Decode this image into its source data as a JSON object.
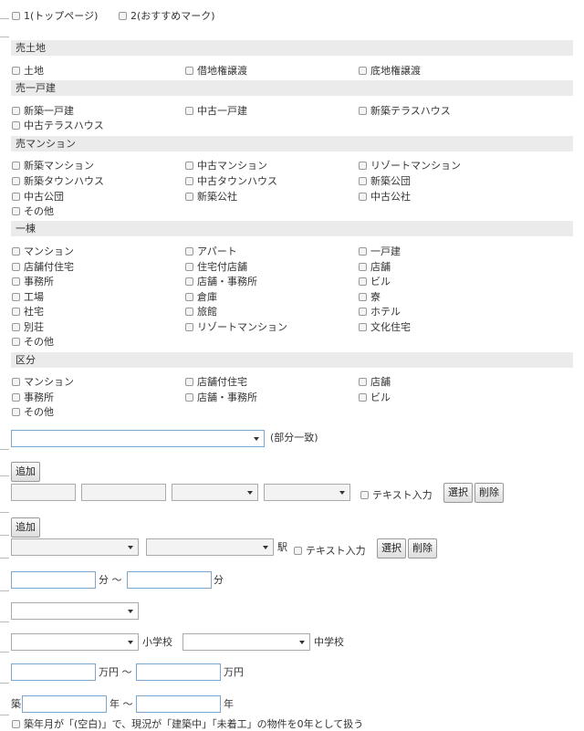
{
  "top": {
    "opt1": "1(トップページ)",
    "opt2": "2(おすすめマーク)"
  },
  "sections": {
    "tochi": {
      "title": "売土地",
      "items": [
        "土地",
        "借地権譲渡",
        "底地権譲渡"
      ]
    },
    "kodate": {
      "title": "売一戸建",
      "items": [
        "新築一戸建",
        "中古一戸建",
        "新築テラスハウス",
        "中古テラスハウス"
      ]
    },
    "mansion": {
      "title": "売マンション",
      "items": [
        "新築マンション",
        "中古マンション",
        "リゾートマンション",
        "新築タウンハウス",
        "中古タウンハウス",
        "新築公団",
        "中古公団",
        "新築公社",
        "中古公社",
        "その他"
      ]
    },
    "ittou": {
      "title": "一棟",
      "items": [
        "マンション",
        "アパート",
        "一戸建",
        "店舗付住宅",
        "住宅付店舗",
        "店舗",
        "事務所",
        "店舗・事務所",
        "ビル",
        "工場",
        "倉庫",
        "寮",
        "社宅",
        "旅館",
        "ホテル",
        "別荘",
        "リゾートマンション",
        "文化住宅",
        "その他"
      ]
    },
    "kubun": {
      "title": "区分",
      "items": [
        "マンション",
        "店舗付住宅",
        "店舗",
        "事務所",
        "店舗・事務所",
        "ビル",
        "その他"
      ]
    }
  },
  "form": {
    "partial_match": "(部分一致)",
    "add_label": "追加",
    "text_input_label": "テキスト入力",
    "select_label": "選択",
    "delete_label": "削除",
    "station_suffix": "駅",
    "minutes": "分",
    "tilde": "〜",
    "elementary": "小学校",
    "junior": "中学校",
    "man_yen": "万円",
    "chiku": "築",
    "nen": "年",
    "note": "築年月が「(空白)」で、現況が「建築中」「未着工」の物件を0年として扱う"
  }
}
